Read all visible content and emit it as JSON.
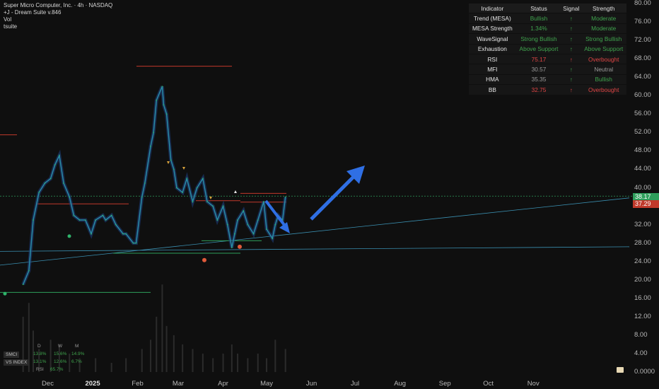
{
  "header": {
    "title": "Super Micro Computer, Inc. · 4h · NASDAQ",
    "indicator": "+J - Dream Suite v.846",
    "vol_label": "Vol",
    "suite_label": "tsuite"
  },
  "chart_data": {
    "type": "line",
    "title": "Super Micro Computer, Inc. · 4h · NASDAQ",
    "x_ticks": [
      "Dec",
      "2025",
      "Feb",
      "Mar",
      "Apr",
      "May",
      "Jun",
      "Jul",
      "Aug",
      "Sep",
      "Oct",
      "Nov"
    ],
    "y_ticks": [
      "80.00",
      "76.00",
      "72.00",
      "68.00",
      "64.00",
      "60.00",
      "56.00",
      "52.00",
      "48.00",
      "44.00",
      "40.00",
      "36.00",
      "32.00",
      "28.00",
      "24.00",
      "20.00",
      "16.00",
      "12.00",
      "8.00",
      "4.00",
      "0.0000"
    ],
    "ylim": [
      0,
      80
    ],
    "grid": false,
    "series": [
      {
        "points": [
          [
            "2024-11-14",
            19.0
          ],
          [
            "2024-11-18",
            22.0
          ],
          [
            "2024-11-21",
            33.0
          ],
          [
            "2024-11-25",
            39.0
          ],
          [
            "2024-11-29",
            41.0
          ],
          [
            "2024-12-03",
            42.0
          ],
          [
            "2024-12-06",
            45.0
          ],
          [
            "2024-12-09",
            47.0
          ],
          [
            "2024-12-12",
            41.0
          ],
          [
            "2024-12-16",
            38.0
          ],
          [
            "2024-12-19",
            34.0
          ],
          [
            "2024-12-23",
            33.0
          ],
          [
            "2024-12-27",
            33.0
          ],
          [
            "2024-12-31",
            30.0
          ],
          [
            "2025-01-03",
            33.0
          ],
          [
            "2025-01-08",
            34.0
          ],
          [
            "2025-01-10",
            33.0
          ],
          [
            "2025-01-14",
            34.0
          ],
          [
            "2025-01-17",
            32.0
          ],
          [
            "2025-01-22",
            30.0
          ],
          [
            "2025-01-24",
            30.0
          ],
          [
            "2025-01-29",
            28.0
          ],
          [
            "2025-01-31",
            28.0
          ],
          [
            "2025-02-04",
            38.0
          ],
          [
            "2025-02-06",
            41.0
          ],
          [
            "2025-02-10",
            49.0
          ],
          [
            "2025-02-12",
            52.0
          ],
          [
            "2025-02-14",
            59.0
          ],
          [
            "2025-02-18",
            62.0
          ],
          [
            "2025-02-19",
            58.0
          ],
          [
            "2025-02-21",
            56.0
          ],
          [
            "2025-02-24",
            46.0
          ],
          [
            "2025-02-26",
            44.0
          ],
          [
            "2025-02-28",
            40.0
          ],
          [
            "2025-03-04",
            39.0
          ],
          [
            "2025-03-07",
            42.0
          ],
          [
            "2025-03-11",
            37.0
          ],
          [
            "2025-03-14",
            40.0
          ],
          [
            "2025-03-18",
            42.0
          ],
          [
            "2025-03-21",
            37.0
          ],
          [
            "2025-03-25",
            36.0
          ],
          [
            "2025-03-28",
            33.0
          ],
          [
            "2025-04-01",
            36.0
          ],
          [
            "2025-04-04",
            32.0
          ],
          [
            "2025-04-07",
            27.0
          ],
          [
            "2025-04-09",
            30.0
          ],
          [
            "2025-04-11",
            33.0
          ],
          [
            "2025-04-15",
            35.0
          ],
          [
            "2025-04-18",
            32.0
          ],
          [
            "2025-04-22",
            30.0
          ],
          [
            "2025-04-25",
            33.0
          ],
          [
            "2025-04-29",
            37.0
          ],
          [
            "2025-05-01",
            31.0
          ],
          [
            "2025-05-05",
            29.0
          ],
          [
            "2025-05-07",
            32.0
          ],
          [
            "2025-05-09",
            34.0
          ],
          [
            "2025-05-12",
            33.0
          ],
          [
            "2025-05-14",
            38.0
          ]
        ]
      }
    ],
    "volume": [
      [
        "2024-11-14",
        12
      ],
      [
        "2024-11-18",
        15
      ],
      [
        "2024-11-21",
        9
      ],
      [
        "2024-11-25",
        5
      ],
      [
        "2024-12-03",
        7
      ],
      [
        "2024-12-09",
        6
      ],
      [
        "2024-12-16",
        4
      ],
      [
        "2024-12-23",
        3
      ],
      [
        "2025-01-03",
        3
      ],
      [
        "2025-01-14",
        2
      ],
      [
        "2025-01-24",
        3
      ],
      [
        "2025-02-04",
        5
      ],
      [
        "2025-02-10",
        7
      ],
      [
        "2025-02-14",
        12
      ],
      [
        "2025-02-18",
        19
      ],
      [
        "2025-02-21",
        10
      ],
      [
        "2025-02-26",
        8
      ],
      [
        "2025-03-04",
        6
      ],
      [
        "2025-03-11",
        5
      ],
      [
        "2025-03-18",
        4
      ],
      [
        "2025-03-25",
        3
      ],
      [
        "2025-04-01",
        4
      ],
      [
        "2025-04-07",
        6
      ],
      [
        "2025-04-11",
        4
      ],
      [
        "2025-04-18",
        3
      ],
      [
        "2025-04-25",
        4
      ],
      [
        "2025-05-01",
        3
      ],
      [
        "2025-05-07",
        7
      ],
      [
        "2025-05-14",
        5
      ]
    ],
    "price_labels": {
      "last": "38.17",
      "previous": "37.29"
    },
    "last_color": "#2e9e5b",
    "previous_color": "#c0392b"
  },
  "indicator_table": {
    "headers": [
      "Indicator",
      "Status",
      "Signal",
      "Strength"
    ],
    "rows": [
      {
        "name": "Trend (MESA)",
        "status": "Bullish",
        "signal": "↑",
        "strength": "Moderate",
        "status_color": "green",
        "signal_color": "green",
        "strength_color": "green"
      },
      {
        "name": "MESA Strength",
        "status": "1.34%",
        "signal": "↑",
        "strength": "Moderate",
        "status_color": "green",
        "signal_color": "green",
        "strength_color": "green"
      },
      {
        "name": "WaveSignal",
        "status": "Strong Bullish",
        "signal": "↑",
        "strength": "Strong Bullish",
        "status_color": "green",
        "signal_color": "green",
        "strength_color": "green"
      },
      {
        "name": "Exhaustion",
        "status": "Above Support",
        "signal": "↑",
        "strength": "Above Support",
        "status_color": "green",
        "signal_color": "green",
        "strength_color": "green"
      },
      {
        "name": "RSI",
        "status": "75.17",
        "signal": "↑",
        "strength": "Overbought",
        "status_color": "red",
        "signal_color": "red",
        "strength_color": "red"
      },
      {
        "name": "MFI",
        "status": "30.57",
        "signal": "↑",
        "strength": "Neutral",
        "status_color": "gray",
        "signal_color": "green",
        "strength_color": "gray"
      },
      {
        "name": "HMA",
        "status": "35.35",
        "signal": "↑",
        "strength": "Bullish",
        "status_color": "gray",
        "signal_color": "green",
        "strength_color": "green"
      },
      {
        "name": "BB",
        "status": "32.75",
        "signal": "↑",
        "strength": "Overbought",
        "status_color": "red",
        "signal_color": "red",
        "strength_color": "red"
      }
    ]
  },
  "performance": {
    "headers": [
      "D",
      "W",
      "M"
    ],
    "rows": [
      {
        "label": "SMCI",
        "values": [
          "13.8%",
          "15.6%",
          "14.9%"
        ]
      },
      {
        "label": "VS INDEX",
        "values": [
          "13.1%",
          "12.6%",
          "6.7%"
        ]
      },
      {
        "label": "RSI",
        "values": [
          "65.7%"
        ]
      }
    ]
  },
  "colors": {
    "background": "#0f0f0f",
    "price_line": "#2a8fa8",
    "price_line_alt": "#2fb36b",
    "arrow": "#2f6fe4",
    "resistance": "#c0392b",
    "support": "#2e9e5b",
    "trendline": "#3a8fb0"
  }
}
